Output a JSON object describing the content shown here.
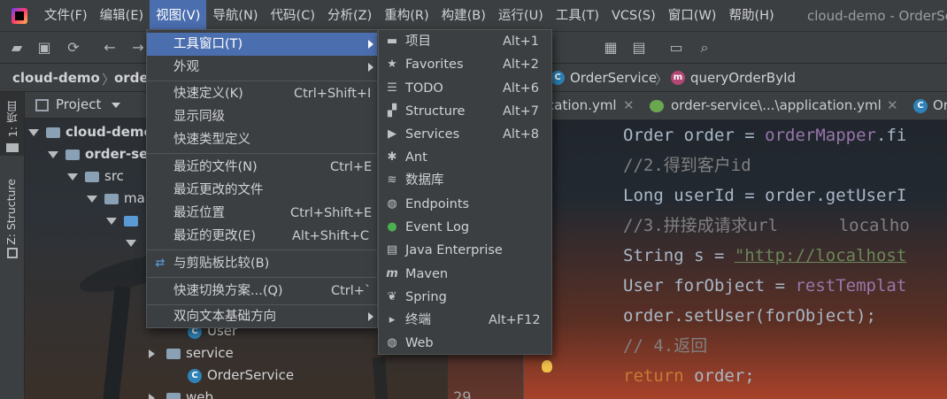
{
  "menubar": {
    "items": [
      "文件(F)",
      "编辑(E)",
      "视图(V)",
      "导航(N)",
      "代码(C)",
      "分析(Z)",
      "重构(R)",
      "构建(B)",
      "运行(U)",
      "工具(T)",
      "VCS(S)",
      "窗口(W)",
      "帮助(H)"
    ],
    "window_title": "cloud-demo - OrderService"
  },
  "navbar": {
    "project": "cloud-demo",
    "module": "order",
    "class": "OrderService",
    "method": "queryOrderById"
  },
  "left_strip": {
    "tab1": "1: 项目",
    "tab2": "Z: Structure"
  },
  "project_panel": {
    "title": "Project",
    "tree": [
      "cloud-demo",
      "order-se",
      "src",
      "ma",
      "User",
      "service",
      "OrderService",
      "web"
    ]
  },
  "editor": {
    "tabs": [
      "cation.yml",
      "order-service\\...\\application.yml",
      "Or"
    ],
    "line_number": "29",
    "code": {
      "l1a": "Order order = ",
      "l1b": "orderMapper",
      "l1c": ".fi",
      "l2": "//2.得到客户id",
      "l3": "Long userId = order.getUserI",
      "l4": "//3.拼接成请求url      localho",
      "l5a": "String s = ",
      "l5b": "\"http://localhost",
      "l6a": "User forObject = ",
      "l6b": "restTemplat",
      "l7": "order.setUser(forObject);",
      "l8": "// 4.返回",
      "l9a": "return",
      "l9b": " order;"
    }
  },
  "view_menu": {
    "items": [
      {
        "label": "工具窗口(T)",
        "shortcut": ""
      },
      {
        "label": "外观",
        "shortcut": ""
      },
      {
        "label": "快速定义(K)",
        "shortcut": "Ctrl+Shift+I"
      },
      {
        "label": "显示同级",
        "shortcut": ""
      },
      {
        "label": "快速类型定义",
        "shortcut": ""
      },
      {
        "label": "最近的文件(N)",
        "shortcut": "Ctrl+E"
      },
      {
        "label": "最近更改的文件",
        "shortcut": ""
      },
      {
        "label": "最近位置",
        "shortcut": "Ctrl+Shift+E"
      },
      {
        "label": "最近的更改(E)",
        "shortcut": "Alt+Shift+C"
      },
      {
        "label": "与剪贴板比较(B)",
        "shortcut": ""
      },
      {
        "label": "快速切换方案...(Q)",
        "shortcut": "Ctrl+`"
      },
      {
        "label": "双向文本基础方向",
        "shortcut": ""
      }
    ]
  },
  "tool_windows_menu": {
    "items": [
      {
        "label": "项目",
        "shortcut": "Alt+1",
        "icon": "folder-icon"
      },
      {
        "label": "Favorites",
        "shortcut": "Alt+2",
        "icon": "star-icon"
      },
      {
        "label": "TODO",
        "shortcut": "Alt+6",
        "icon": "list-icon"
      },
      {
        "label": "Structure",
        "shortcut": "Alt+7",
        "icon": "structure-icon"
      },
      {
        "label": "Services",
        "shortcut": "Alt+8",
        "icon": "services-icon"
      },
      {
        "label": "Ant",
        "shortcut": "",
        "icon": "ant-icon"
      },
      {
        "label": "数据库",
        "shortcut": "",
        "icon": "database-icon"
      },
      {
        "label": "Endpoints",
        "shortcut": "",
        "icon": "globe-icon"
      },
      {
        "label": "Event Log",
        "shortcut": "",
        "icon": "event-log-icon"
      },
      {
        "label": "Java Enterprise",
        "shortcut": "",
        "icon": "java-enterprise-icon"
      },
      {
        "label": "Maven",
        "shortcut": "",
        "icon": "maven-icon"
      },
      {
        "label": "Spring",
        "shortcut": "",
        "icon": "spring-icon"
      },
      {
        "label": "终端",
        "shortcut": "Alt+F12",
        "icon": "terminal-icon"
      },
      {
        "label": "Web",
        "shortcut": "",
        "icon": "web-icon"
      }
    ]
  },
  "colors": {
    "selection": "#4b6eaf",
    "menu_bg": "#3c3f41",
    "keyword": "#cc7832",
    "field": "#9876aa",
    "comment": "#808080",
    "string": "#6a8759"
  }
}
